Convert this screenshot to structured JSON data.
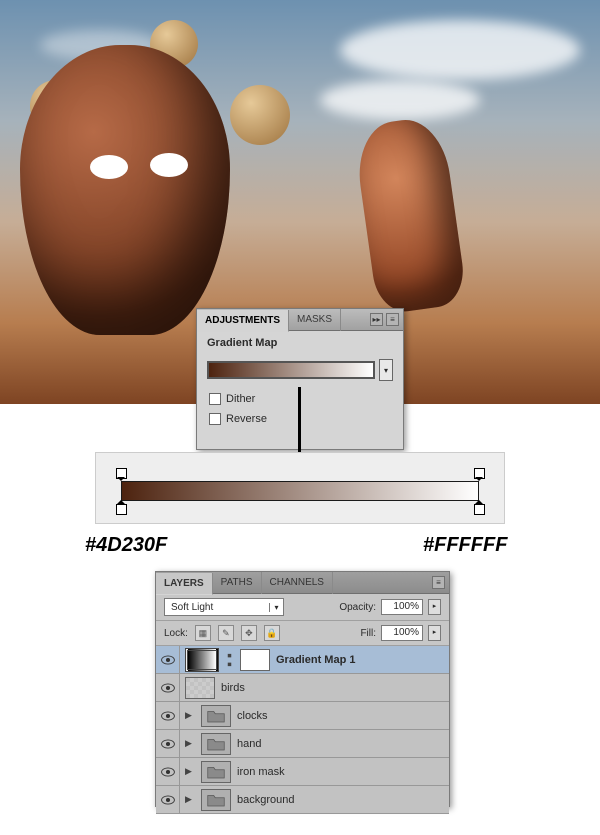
{
  "gradient": {
    "color_start": "#4D230F",
    "color_end": "#FFFFFF"
  },
  "hex_left": "#4D230F",
  "hex_right": "#FFFFFF",
  "adjustments": {
    "tabs": {
      "adjustments": "ADJUSTMENTS",
      "masks": "MASKS"
    },
    "title": "Gradient Map",
    "dither": "Dither",
    "reverse": "Reverse"
  },
  "layers_panel": {
    "tabs": {
      "layers": "LAYERS",
      "paths": "PATHS",
      "channels": "CHANNELS"
    },
    "blend_mode": "Soft Light",
    "opacity_label": "Opacity:",
    "opacity_value": "100%",
    "lock_label": "Lock:",
    "fill_label": "Fill:",
    "fill_value": "100%",
    "layers": [
      {
        "name": "Gradient Map 1",
        "type": "adjustment",
        "selected": true
      },
      {
        "name": "birds",
        "type": "raster",
        "selected": false
      },
      {
        "name": "clocks",
        "type": "group",
        "selected": false
      },
      {
        "name": "hand",
        "type": "group",
        "selected": false
      },
      {
        "name": "iron mask",
        "type": "group",
        "selected": false
      },
      {
        "name": "background",
        "type": "group",
        "selected": false
      }
    ]
  }
}
